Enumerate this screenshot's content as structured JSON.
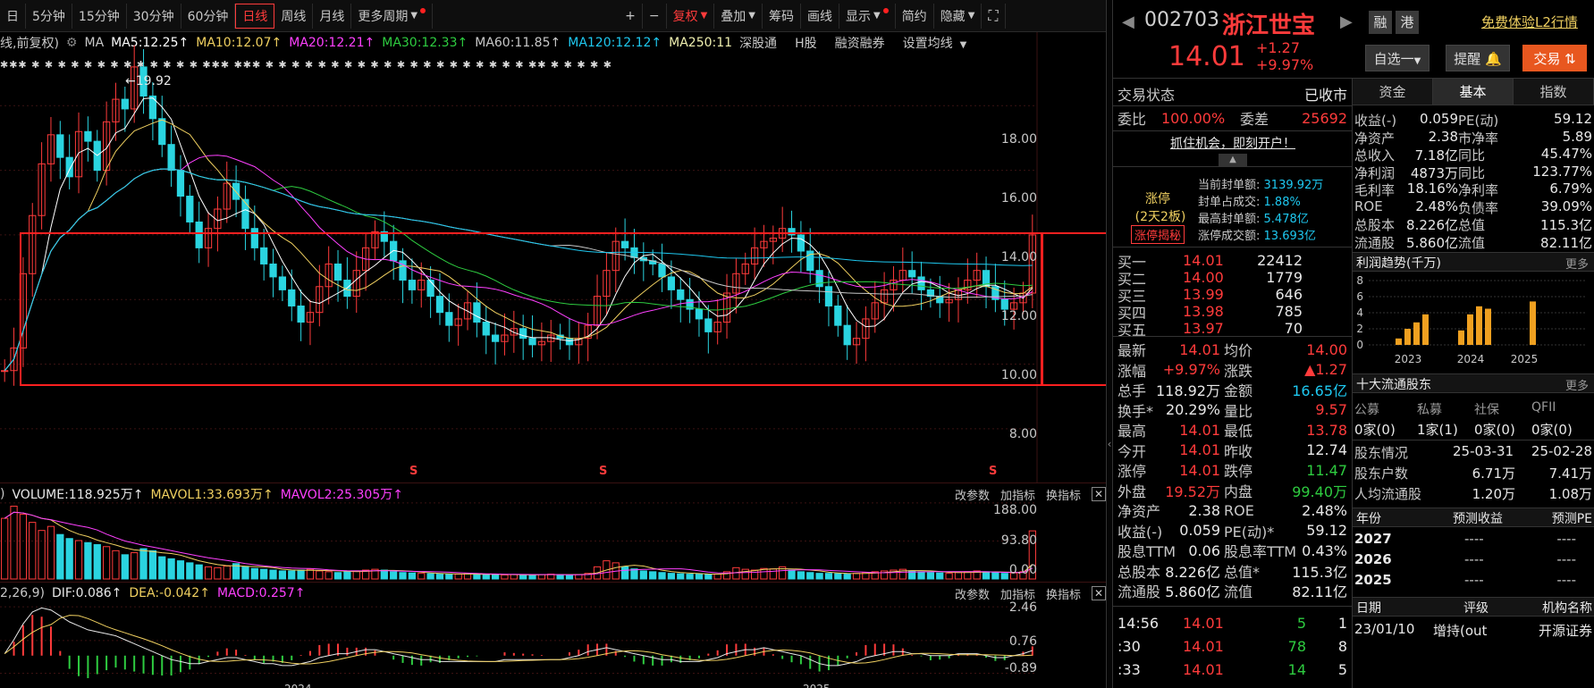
{
  "toolbar": {
    "items": [
      "日",
      "5分钟",
      "15分钟",
      "30分钟",
      "60分钟",
      "日线",
      "周线",
      "月线",
      "更多周期"
    ],
    "active": "日线",
    "right_items": [
      "+",
      "−",
      "复权",
      "叠加",
      "筹码",
      "画线",
      "显示",
      "简约",
      "隐藏"
    ],
    "fullscreen_icon": "expand-icon"
  },
  "main": {
    "ma_label": "线,前复权)",
    "ma_items": [
      {
        "text": "MA",
        "color": "#c8c8c8"
      },
      {
        "text": "MA5:12.25↑",
        "color": "#ffffff"
      },
      {
        "text": "MA10:12.07↑",
        "color": "#f0d060"
      },
      {
        "text": "MA20:12.21↑",
        "color": "#ff40ff"
      },
      {
        "text": "MA30:12.33↑",
        "color": "#2ecc40"
      },
      {
        "text": "MA60:11.85↑",
        "color": "#c8c8c8"
      },
      {
        "text": "MA120:12.12↑",
        "color": "#1ec8f0"
      },
      {
        "text": "MA250:11",
        "color": "#f0f0b0"
      }
    ],
    "tabs": [
      "深股通",
      "H股",
      "融资融券",
      "设置均线"
    ],
    "high_label": "←19.92",
    "yticks": [
      "18.00",
      "16.00",
      "14.00",
      "12.00",
      "10.00",
      "8.00"
    ],
    "markers": [
      "S",
      "S",
      "S"
    ]
  },
  "volume": {
    "items": [
      {
        "text": ")",
        "color": "#c8c8c8"
      },
      {
        "text": "VOLUME:118.925万↑",
        "color": "#e8e8e8"
      },
      {
        "text": "MAVOL1:33.693万↑",
        "color": "#f0d060"
      },
      {
        "text": "MAVOL2:25.305万↑",
        "color": "#ff40ff"
      }
    ],
    "yticks": [
      "188.00",
      "93.80",
      "0.00"
    ],
    "tools": [
      "改参数",
      "加指标",
      "换指标"
    ]
  },
  "macd": {
    "items": [
      {
        "text": "2,26,9)",
        "color": "#c8c8c8"
      },
      {
        "text": "DIF:0.086↑",
        "color": "#e8e8e8"
      },
      {
        "text": "DEA:-0.042↑",
        "color": "#f0d060"
      },
      {
        "text": "MACD:0.257↑",
        "color": "#ff40ff"
      }
    ],
    "yticks": [
      "2.46",
      "0.76",
      "-0.89"
    ],
    "tools": [
      "改参数",
      "加指标",
      "换指标"
    ],
    "xlabels": [
      "2024",
      "2025"
    ]
  },
  "stock": {
    "code": "002703",
    "name": "浙江世宝",
    "badges": [
      "融",
      "港"
    ],
    "free_l2": "免费体验L2行情",
    "price": "14.01",
    "change": "+1.27",
    "change_pct": "+9.97%",
    "buttons": {
      "watch": "自选一",
      "remind": "提醒",
      "trade": "交易"
    }
  },
  "quote": {
    "status_label": "交易状态",
    "status_value": "已收市",
    "weibi_label": "委比",
    "weibi_value": "100.00%",
    "weicha_label": "委差",
    "weicha_value": "25692",
    "promo": "抓住机会，即刻开户！",
    "limit_title": "涨停",
    "limit_sub": "(2天2板)",
    "limit_btn": "涨停揭秘",
    "limit_info": [
      {
        "label": "当前封单额:",
        "value": "3139.92万"
      },
      {
        "label": "封单占成交:",
        "value": "1.88%"
      },
      {
        "label": "最高封单额:",
        "value": "5.478亿"
      },
      {
        "label": "涨停成交额:",
        "value": "13.693亿"
      }
    ],
    "bids": [
      {
        "label": "买一",
        "price": "14.01",
        "vol": "22412"
      },
      {
        "label": "买二",
        "price": "14.00",
        "vol": "1779"
      },
      {
        "label": "买三",
        "price": "13.99",
        "vol": "646"
      },
      {
        "label": "买四",
        "price": "13.98",
        "vol": "785"
      },
      {
        "label": "买五",
        "price": "13.97",
        "vol": "70"
      }
    ],
    "stats": [
      {
        "l1": "最新",
        "v1": "14.01",
        "c1": "red",
        "l2": "均价",
        "v2": "14.00",
        "c2": "red"
      },
      {
        "l1": "涨幅",
        "v1": "+9.97%",
        "c1": "red",
        "l2": "涨跌",
        "v2": "▲1.27",
        "c2": "red"
      },
      {
        "l1": "总手",
        "v1": "118.92万",
        "c1": "white",
        "l2": "金额",
        "v2": "16.65亿",
        "c2": "cyan"
      },
      {
        "l1": "换手*",
        "v1": "20.29%",
        "c1": "white",
        "l2": "量比",
        "v2": "9.57",
        "c2": "red"
      },
      {
        "l1": "最高",
        "v1": "14.01",
        "c1": "red",
        "l2": "最低",
        "v2": "13.78",
        "c2": "red"
      },
      {
        "l1": "今开",
        "v1": "14.01",
        "c1": "red",
        "l2": "昨收",
        "v2": "12.74",
        "c2": "white"
      },
      {
        "l1": "涨停",
        "v1": "14.01",
        "c1": "red",
        "l2": "跌停",
        "v2": "11.47",
        "c2": "green"
      },
      {
        "l1": "外盘",
        "v1": "19.52万",
        "c1": "red",
        "l2": "内盘",
        "v2": "99.40万",
        "c2": "green"
      },
      {
        "l1": "净资产",
        "v1": "2.38",
        "c1": "white",
        "l2": "ROE",
        "v2": "2.48%",
        "c2": "white"
      },
      {
        "l1": "收益(-)",
        "v1": "0.059",
        "c1": "white",
        "l2": "PE(动)*",
        "v2": "59.12",
        "c2": "white"
      },
      {
        "l1": "股息TTM",
        "v1": "0.06",
        "c1": "white",
        "l2": "股息率TTM",
        "v2": "0.43%",
        "c2": "white"
      },
      {
        "l1": "总股本",
        "v1": "8.226亿",
        "c1": "white",
        "l2": "总值*",
        "v2": "115.3亿",
        "c2": "white"
      },
      {
        "l1": "流通股",
        "v1": "5.860亿",
        "c1": "white",
        "l2": "流值",
        "v2": "82.11亿",
        "c2": "white"
      }
    ],
    "ticks": [
      {
        "t": "14:56",
        "p": "14.01",
        "v": "5",
        "n": "1"
      },
      {
        "t": ":30",
        "p": "14.01",
        "v": "78",
        "n": "8"
      },
      {
        "t": ":33",
        "p": "14.01",
        "v": "14",
        "n": "5"
      }
    ]
  },
  "fund": {
    "tabs": [
      "资金",
      "基本",
      "指数"
    ],
    "active": "基本",
    "rows": [
      {
        "l1": "收益(-)",
        "v1": "0.059",
        "l2": "PE(动)",
        "v2": "59.12"
      },
      {
        "l1": "净资产",
        "v1": "2.38",
        "l2": "市净率",
        "v2": "5.89"
      },
      {
        "l1": "总收入",
        "v1": "7.18亿",
        "l2": "同比",
        "v2": "45.47%"
      },
      {
        "l1": "净利润",
        "v1": "4873万",
        "l2": "同比",
        "v2": "123.77%"
      },
      {
        "l1": "毛利率",
        "v1": "18.16%",
        "l2": "净利率",
        "v2": "6.79%"
      },
      {
        "l1": "ROE",
        "v1": "2.48%",
        "l2": "负债率",
        "v2": "39.09%"
      },
      {
        "l1": "总股本",
        "v1": "8.226亿",
        "l2": "总值",
        "v2": "115.3亿"
      },
      {
        "l1": "流通股",
        "v1": "5.860亿",
        "l2": "流值",
        "v2": "82.11亿"
      }
    ],
    "profit_title": "利润趋势(千万)",
    "more": "更多",
    "profit_yticks": [
      "8",
      "6",
      "4",
      "2",
      "0"
    ],
    "profit_years": [
      "2023",
      "2024",
      "2025"
    ],
    "holders_title": "十大流通股东",
    "holder_types": [
      "公募",
      "私募",
      "社保",
      "QFII"
    ],
    "holder_values": [
      "0家(0)",
      "1家(1)",
      "0家(0)",
      "0家(0)"
    ],
    "holder_label": "股东情况",
    "holder_dates": [
      "25-03-31",
      "25-02-28"
    ],
    "holder_rows": [
      {
        "l": "股东户数",
        "a": "6.71万",
        "b": "7.41万"
      },
      {
        "l": "人均流通股",
        "a": "1.20万",
        "b": "1.08万"
      }
    ],
    "forecast_head": [
      "年份",
      "预测收益",
      "预测PE"
    ],
    "forecast_rows": [
      {
        "y": "2027",
        "a": "----",
        "b": "----"
      },
      {
        "y": "2026",
        "a": "----",
        "b": "----"
      },
      {
        "y": "2025",
        "a": "----",
        "b": "----"
      }
    ],
    "rating_head": [
      "日期",
      "评级",
      "机构名称"
    ],
    "rating_row": {
      "d": "23/01/10",
      "r": "增持(out",
      "o": "开源证券"
    }
  },
  "chart_data": [
    {
      "type": "candlestick",
      "title": "",
      "ylim": [
        7,
        20
      ],
      "yticks": [
        8,
        10,
        12,
        14,
        16,
        18
      ],
      "close_series": [
        9.8,
        10.5,
        12.8,
        14.6,
        16.2,
        17.1,
        16.4,
        15.8,
        17.2,
        16.9,
        16.0,
        17.5,
        18.2,
        17.9,
        19.2,
        18.3,
        17.6,
        16.8,
        16.0,
        15.2,
        14.4,
        13.6,
        14.2,
        14.8,
        15.6,
        15.1,
        14.2,
        13.6,
        13.1,
        12.7,
        12.3,
        11.8,
        11.3,
        11.6,
        12.4,
        13.1,
        12.6,
        12.1,
        12.9,
        13.6,
        14.1,
        13.8,
        13.2,
        12.6,
        12.3,
        12.6,
        12.1,
        11.6,
        11.2,
        11.4,
        11.9,
        11.3,
        10.9,
        10.7,
        10.9,
        11.1,
        10.8,
        10.6,
        10.7,
        10.9,
        10.8,
        10.6,
        10.8,
        11.2,
        12.1,
        12.9,
        13.8,
        13.6,
        13.3,
        13.2,
        13.1,
        12.7,
        12.3,
        12.0,
        11.7,
        11.4,
        11.0,
        11.3,
        12.2,
        12.8,
        13.1,
        13.6,
        13.8,
        13.9,
        14.2,
        14.0,
        13.5,
        12.9,
        12.4,
        11.8,
        11.2,
        10.6,
        10.8,
        11.4,
        11.9,
        12.3,
        12.6,
        12.9,
        12.7,
        12.3,
        12.1,
        11.9,
        12.0,
        12.3,
        12.6,
        12.9,
        12.4,
        12.0,
        11.7,
        11.9,
        12.2,
        14.0
      ],
      "volume_series": [
        150,
        180,
        160,
        140,
        120,
        130,
        110,
        100,
        95,
        90,
        85,
        80,
        70,
        60,
        65,
        75,
        70,
        55,
        50,
        45,
        40,
        35,
        30,
        28,
        32,
        38,
        30,
        26,
        24,
        22,
        20,
        20,
        22,
        24,
        20,
        18,
        16,
        18,
        20,
        22,
        24,
        22,
        18,
        16,
        15,
        14,
        13,
        12,
        11,
        12,
        13,
        12,
        11,
        10,
        10,
        11,
        10,
        10,
        11,
        12,
        11,
        10,
        11,
        14,
        30,
        45,
        40,
        30,
        25,
        20,
        18,
        16,
        14,
        13,
        12,
        12,
        11,
        12,
        18,
        28,
        24,
        22,
        26,
        25,
        30,
        22,
        18,
        16,
        14,
        14,
        13,
        12,
        14,
        16,
        18,
        20,
        22,
        24,
        20,
        18,
        16,
        15,
        14,
        16,
        18,
        20,
        18,
        16,
        14,
        15,
        18,
        119
      ],
      "macd_series": [
        0.1,
        0.8,
        1.6,
        2.2,
        2.4,
        2.3,
        2.0,
        1.7,
        1.5,
        1.3,
        1.2,
        1.1,
        1.0,
        0.8,
        0.6,
        0.4,
        0.2,
        0.0,
        -0.2,
        -0.3,
        -0.4,
        -0.4,
        -0.3,
        -0.2,
        -0.1,
        -0.1,
        -0.2,
        -0.3,
        -0.4,
        -0.4,
        -0.5,
        -0.5,
        -0.4,
        -0.3,
        -0.1,
        0.0,
        0.1,
        0.1,
        0.2,
        0.3,
        0.3,
        0.2,
        0.1,
        0.0,
        -0.1,
        -0.2,
        -0.2,
        -0.3,
        -0.3,
        -0.3,
        -0.3,
        -0.3,
        -0.3,
        -0.3,
        -0.2,
        -0.2,
        -0.2,
        -0.2,
        -0.2,
        -0.2,
        -0.2,
        -0.1,
        0.0,
        0.2,
        0.3,
        0.4,
        0.3,
        0.2,
        0.1,
        0.0,
        -0.1,
        -0.2,
        -0.2,
        -0.3,
        -0.3,
        -0.3,
        -0.2,
        -0.1,
        0.1,
        0.2,
        0.3,
        0.3,
        0.4,
        0.3,
        0.2,
        0.1,
        0.0,
        -0.2,
        -0.4,
        -0.5,
        -0.5,
        -0.4,
        -0.3,
        -0.1,
        0.0,
        0.1,
        0.2,
        0.2,
        0.1,
        0.1,
        0.0,
        0.0,
        0.0,
        0.1,
        0.1,
        0.1,
        0.0,
        -0.1,
        -0.1,
        0.0,
        0.1,
        0.26
      ]
    },
    {
      "type": "bar",
      "title": "利润趋势(千万)",
      "categories": [
        "2023Q1",
        "2023Q2",
        "2023Q3",
        "2023Q4",
        "2024Q1",
        "2024Q2",
        "2024Q3",
        "2024Q4",
        "2025Q1"
      ],
      "values": [
        0.8,
        2.0,
        2.8,
        3.8,
        1.8,
        3.8,
        4.8,
        4.5,
        5.4
      ],
      "ylim": [
        0,
        8
      ]
    }
  ]
}
